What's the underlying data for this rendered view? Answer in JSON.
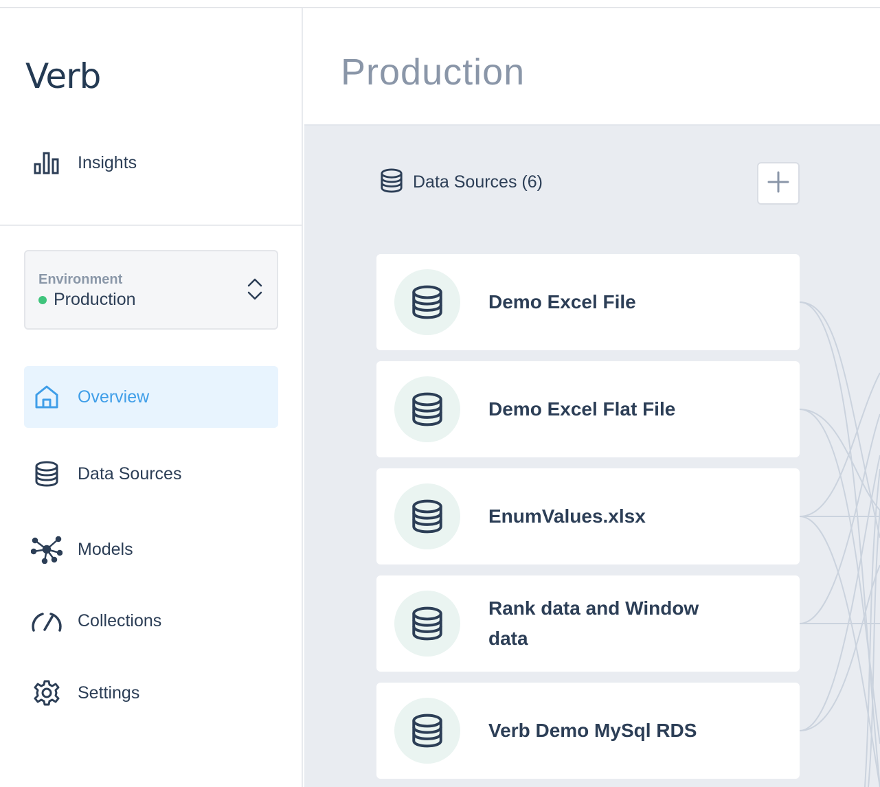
{
  "app": {
    "logo": "Verb"
  },
  "sidebar": {
    "insights_label": "Insights",
    "environment": {
      "label": "Environment",
      "value": "Production",
      "status_color": "#3fc47c"
    },
    "nav": [
      {
        "label": "Overview",
        "icon": "home-icon",
        "active": true
      },
      {
        "label": "Data Sources",
        "icon": "database-icon",
        "active": false
      },
      {
        "label": "Models",
        "icon": "network-icon",
        "active": false
      },
      {
        "label": "Collections",
        "icon": "gauge-icon",
        "active": false
      },
      {
        "label": "Settings",
        "icon": "gear-icon",
        "active": false
      }
    ]
  },
  "header": {
    "title": "Production"
  },
  "main": {
    "data_sources_label": "Data Sources (6)",
    "add_icon": "plus-icon",
    "sources": [
      {
        "name": "Demo Excel File"
      },
      {
        "name": "Demo Excel Flat File"
      },
      {
        "name": "EnumValues.xlsx"
      },
      {
        "name": "Rank data and Window data"
      },
      {
        "name": "Verb Demo MySql RDS"
      }
    ]
  },
  "colors": {
    "accent": "#3f9ee8",
    "text": "#2c3e56",
    "muted": "#8a96a8",
    "panel": "#e9ecf1"
  }
}
